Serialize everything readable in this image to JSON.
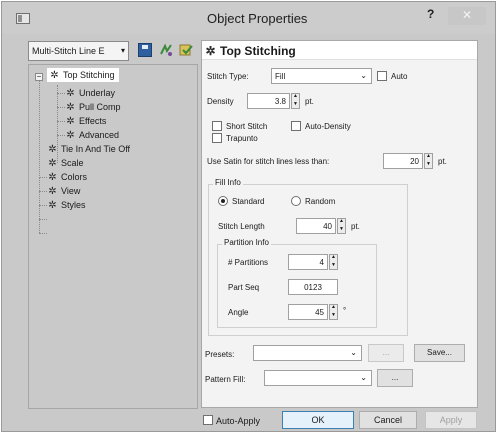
{
  "window": {
    "title": "Object Properties",
    "help_label": "?",
    "close_label": "✕"
  },
  "toolbar": {
    "object_select": "Multi-Stitch Line E",
    "save_icon": "save-icon",
    "icon_2": "stitch-tool-icon",
    "icon_3": "stitch-apply-icon"
  },
  "tree": {
    "items": [
      {
        "label": "Top Stitching",
        "icon": "gear-icon",
        "selected": true
      },
      {
        "label": "Underlay",
        "icon": "gear-icon"
      },
      {
        "label": "Pull Comp",
        "icon": "gear-icon"
      },
      {
        "label": "Effects",
        "icon": "gear-icon"
      },
      {
        "label": "Advanced",
        "icon": "gear-icon"
      },
      {
        "label": "Tie In And Tie Off",
        "icon": "gear-icon"
      },
      {
        "label": "Scale",
        "icon": "gear-icon"
      },
      {
        "label": "Colors",
        "icon": "gear-icon"
      },
      {
        "label": "View",
        "icon": "gear-icon"
      },
      {
        "label": "Styles",
        "icon": "gear-icon"
      }
    ],
    "expander_symbol": "−"
  },
  "panel": {
    "title": "Top Stitching",
    "stitch_type": {
      "label": "Stitch Type:",
      "value": "Fill"
    },
    "auto": {
      "label": "Auto",
      "checked": false
    },
    "density": {
      "label": "Density",
      "value": "3.8",
      "unit": "pt."
    },
    "short_stitch": {
      "label": "Short Stitch",
      "checked": false
    },
    "auto_density": {
      "label": "Auto-Density",
      "checked": false
    },
    "trapunto": {
      "label": "Trapunto",
      "checked": false
    },
    "satin": {
      "label": "Use Satin for stitch lines less than:",
      "value": "20",
      "unit": "pt."
    },
    "fill_info": {
      "title": "Fill Info",
      "standard": "Standard",
      "random": "Random",
      "selected": "Standard",
      "stitch_length": {
        "label": "Stitch Length",
        "value": "40",
        "unit": "pt."
      },
      "partition_info": {
        "title": "Partition Info",
        "partitions": {
          "label": "# Partitions",
          "value": "4"
        },
        "part_seq": {
          "label": "Part Seq",
          "value": "0123"
        },
        "angle": {
          "label": "Angle",
          "value": "45",
          "unit": "°"
        }
      }
    },
    "presets": {
      "label": "Presets:",
      "value": "",
      "browse": "...",
      "save": "Save..."
    },
    "pattern_fill": {
      "label": "Pattern Fill:",
      "value": "",
      "browse": "..."
    }
  },
  "footer": {
    "auto_apply": {
      "label": "Auto-Apply",
      "checked": false
    },
    "ok": "OK",
    "cancel": "Cancel",
    "apply": "Apply"
  }
}
